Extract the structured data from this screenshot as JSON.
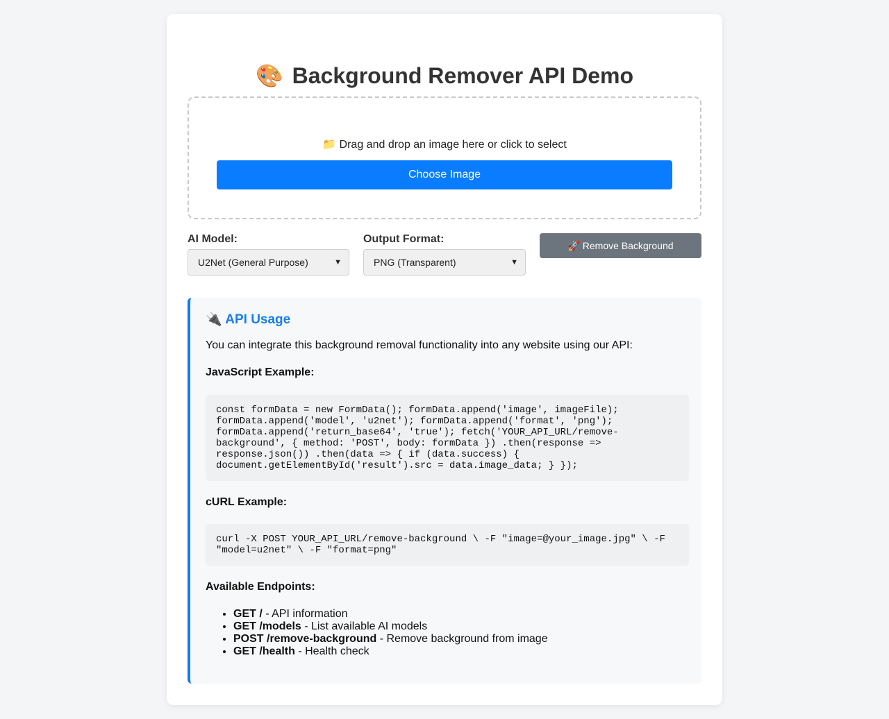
{
  "header": {
    "emoji": "🎨",
    "title": "Background Remover API Demo"
  },
  "upload": {
    "hint_icon": "📁",
    "hint": "Drag and drop an image here or click to select",
    "button": "Choose Image"
  },
  "controls": {
    "model_label": "AI Model:",
    "model_value": "U2Net (General Purpose)",
    "format_label": "Output Format:",
    "format_value": "PNG (Transparent)",
    "remove_icon": "🚀",
    "remove_label": "Remove Background"
  },
  "api": {
    "icon": "🔌",
    "title": "API Usage",
    "intro": "You can integrate this background removal functionality into any website using our API:",
    "js_heading": "JavaScript Example:",
    "js_code": "const formData = new FormData(); formData.append('image', imageFile);\nformData.append('model', 'u2net'); formData.append('format', 'png');\nformData.append('return_base64', 'true'); fetch('YOUR_API_URL/remove-\nbackground', { method: 'POST', body: formData }) .then(response =>\nresponse.json()) .then(data => { if (data.success) {\ndocument.getElementById('result').src = data.image_data; } });",
    "curl_heading": "cURL Example:",
    "curl_code": "curl -X POST YOUR_API_URL/remove-background \\ -F \"image=@your_image.jpg\" \\ -F\n\"model=u2net\" \\ -F \"format=png\"",
    "endpoints_heading": "Available Endpoints:",
    "endpoints": [
      {
        "route": "GET /",
        "desc": " - API information"
      },
      {
        "route": "GET /models",
        "desc": " - List available AI models"
      },
      {
        "route": "POST /remove-background",
        "desc": " - Remove background from image"
      },
      {
        "route": "GET /health",
        "desc": " - Health check"
      }
    ]
  }
}
